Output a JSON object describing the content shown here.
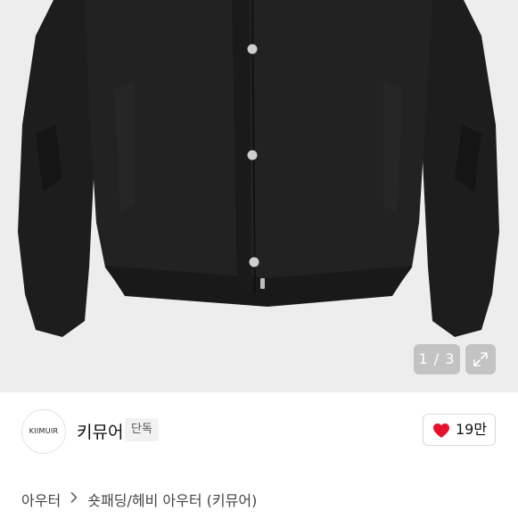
{
  "gallery": {
    "page_indicator": "1 / 3",
    "expand_icon": "expand-arrows-icon",
    "product_colors": {
      "background": "#ededed",
      "jacket": "#1c1c1c",
      "buttons": "#cfcfcf"
    }
  },
  "brand": {
    "logo_text": "KIIMUIR",
    "name": "키뮤어",
    "tag": "단독"
  },
  "like": {
    "icon": "heart-icon",
    "icon_color": "#e8112d",
    "count": "19만"
  },
  "breadcrumb": {
    "items": [
      "아우터",
      "숏패딩/헤비 아우터 (키뮤어)"
    ],
    "separator_icon": "chevron-right-icon"
  }
}
